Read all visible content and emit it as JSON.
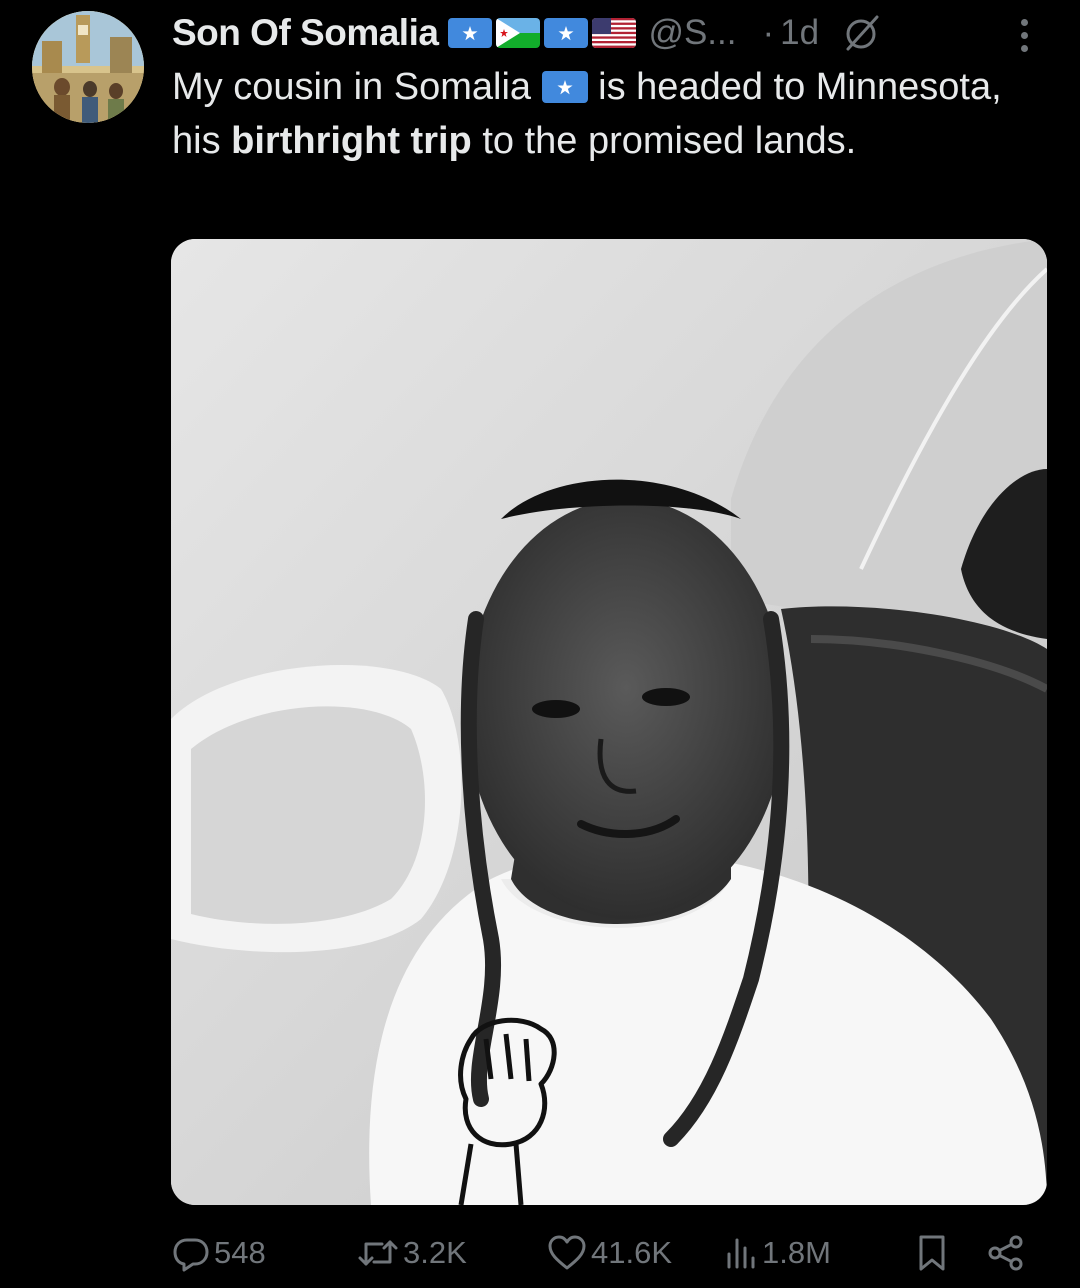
{
  "author": {
    "display_name": "Son Of Somalia",
    "handle": "@S...",
    "time": "1d",
    "separator": "·",
    "flags": [
      "somalia-flag",
      "djibouti-flag",
      "somalia-flag",
      "usa-flag"
    ]
  },
  "tweet": {
    "text_before_flag": "My cousin in Somalia",
    "text_after_flag": "is headed to Minnesota, his",
    "bold_text": "birthright trip",
    "text_end": "to the promised lands."
  },
  "actions": {
    "replies": "548",
    "reposts": "3.2K",
    "likes": "41.6K",
    "views": "1.8M"
  },
  "icons": {
    "reply": "reply-icon",
    "repost": "repost-icon",
    "like": "heart-icon",
    "views": "views-icon",
    "bookmark": "bookmark-icon",
    "share": "share-icon",
    "grok": "grok-icon",
    "more": "more-icon"
  },
  "colors": {
    "background": "#000000",
    "text": "#e7e9ea",
    "secondary": "#71767b",
    "somalia_blue": "#4189dd"
  }
}
